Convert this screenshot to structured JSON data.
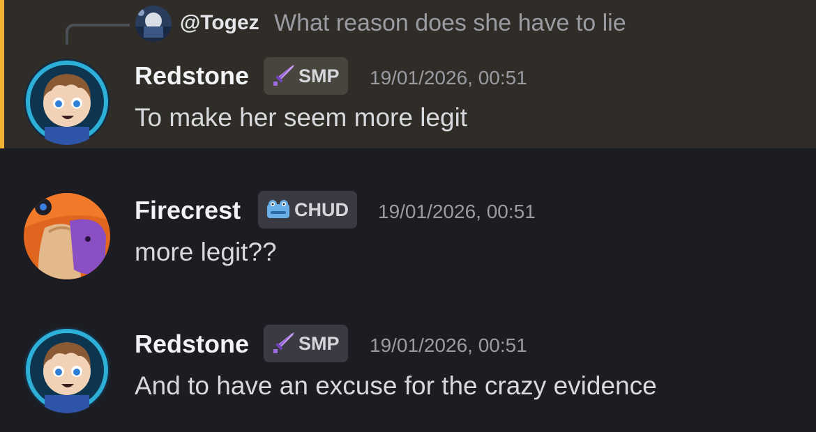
{
  "reply": {
    "username": "@Togez",
    "text": "What reason does she have to lie"
  },
  "messages": [
    {
      "author": "Redstone",
      "tag": "SMP",
      "tag_icon": "sword-icon",
      "timestamp": "19/01/2026, 00:51",
      "text": "To make her seem more legit",
      "highlighted": true
    },
    {
      "author": "Firecrest",
      "tag": "CHUD",
      "tag_icon": "frog-icon",
      "timestamp": "19/01/2026, 00:51",
      "text": "more legit??",
      "highlighted": false
    },
    {
      "author": "Redstone",
      "tag": "SMP",
      "tag_icon": "sword-icon",
      "timestamp": "19/01/2026, 00:51",
      "text": "And to have an excuse for the crazy evidence",
      "highlighted": false
    }
  ],
  "colors": {
    "background": "#1c1d22",
    "highlight_background": "#302d29",
    "highlight_bar": "#f0b232",
    "tag_background": "#3a3b42",
    "timestamp": "#9a9ca2"
  }
}
